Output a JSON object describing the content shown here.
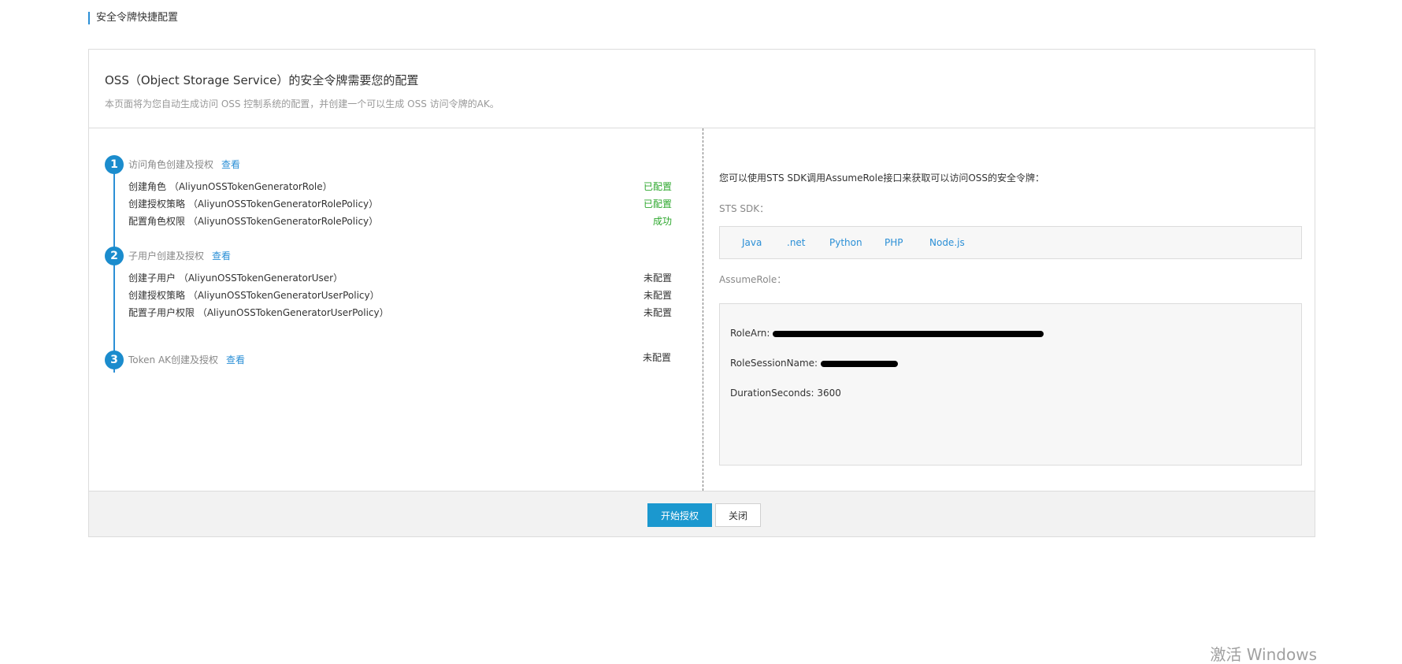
{
  "page_title": "安全令牌快捷配置",
  "header": {
    "title": "OSS（Object Storage Service）的安全令牌需要您的配置",
    "subtitle": "本页面将为您自动生成访问 OSS 控制系统的配置，并创建一个可以生成 OSS 访问令牌的AK。"
  },
  "steps": [
    {
      "number": "1",
      "title": "访问角色创建及授权",
      "link": "查看",
      "items": [
        {
          "label": "创建角色 （AliyunOSSTokenGeneratorRole）",
          "status": "已配置",
          "status_color": "#2ea82e"
        },
        {
          "label": "创建授权策略 （AliyunOSSTokenGeneratorRolePolicy）",
          "status": "已配置",
          "status_color": "#2ea82e"
        },
        {
          "label": "配置角色权限 （AliyunOSSTokenGeneratorRolePolicy）",
          "status": "成功",
          "status_color": "#2ea82e"
        }
      ]
    },
    {
      "number": "2",
      "title": "子用户创建及授权",
      "link": "查看",
      "items": [
        {
          "label": "创建子用户 （AliyunOSSTokenGeneratorUser）",
          "status": "未配置",
          "status_color": "#333333"
        },
        {
          "label": "创建授权策略 （AliyunOSSTokenGeneratorUserPolicy）",
          "status": "未配置",
          "status_color": "#333333"
        },
        {
          "label": "配置子用户权限 （AliyunOSSTokenGeneratorUserPolicy）",
          "status": "未配置",
          "status_color": "#333333"
        }
      ]
    },
    {
      "number": "3",
      "title": "Token AK创建及授权",
      "link": "查看",
      "status": "未配置"
    }
  ],
  "right": {
    "intro": "您可以使用STS SDK调用AssumeRole接口来获取可以访问OSS的安全令牌：",
    "sdk_label": "STS SDK：",
    "sdk_links": [
      "Java",
      ".net",
      "Python",
      "PHP",
      "Node.js"
    ],
    "assume_label": "AssumeRole：",
    "role_arn_label": "RoleArn:",
    "session_label": "RoleSessionName:",
    "duration_label": "DurationSeconds: 3600"
  },
  "footer": {
    "primary_label": "开始授权",
    "close_label": "关闭"
  },
  "watermark": "激活 Windows",
  "colors": {
    "accent": "#1b98cf",
    "link": "#2b8fd6",
    "success": "#2ea82e",
    "border": "#dcdcdc"
  }
}
